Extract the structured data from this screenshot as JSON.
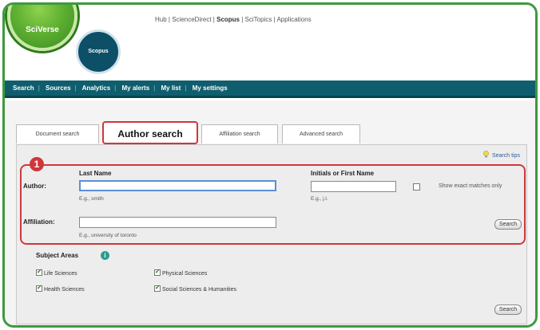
{
  "header": {
    "brand": "SciVerse",
    "product": "Scopus",
    "top_links": [
      "Hub",
      "ScienceDirect",
      "Scopus",
      "SciTopics",
      "Applications"
    ]
  },
  "nav": {
    "items": [
      "Search",
      "Sources",
      "Analytics",
      "My alerts",
      "My list",
      "My settings"
    ]
  },
  "tabs": [
    "Document search",
    "Author search",
    "Affiliation search",
    "Advanced search"
  ],
  "search_tips": "Search tips",
  "form": {
    "badge": "1",
    "author_label": "Author:",
    "last_name_label": "Last Name",
    "last_name_value": "",
    "last_name_hint": "E.g., smith",
    "initials_label": "Initials or First Name",
    "initials_value": "",
    "initials_hint": "E.g., j.l.",
    "exact_label": "Show exact matches only",
    "affiliation_label": "Affiliation:",
    "affiliation_value": "",
    "affiliation_hint": "E.g., university of toronto",
    "search_button": "Search"
  },
  "subject_areas": {
    "title": "Subject Areas",
    "info_icon": "i",
    "items": [
      "Life Sciences",
      "Physical Sciences",
      "Health Sciences",
      "Social Sciences & Humanities"
    ],
    "search_button": "Search"
  },
  "colors": {
    "frame": "#3d9a3d",
    "nav": "#0f5e6e",
    "highlight": "#d0363d"
  }
}
